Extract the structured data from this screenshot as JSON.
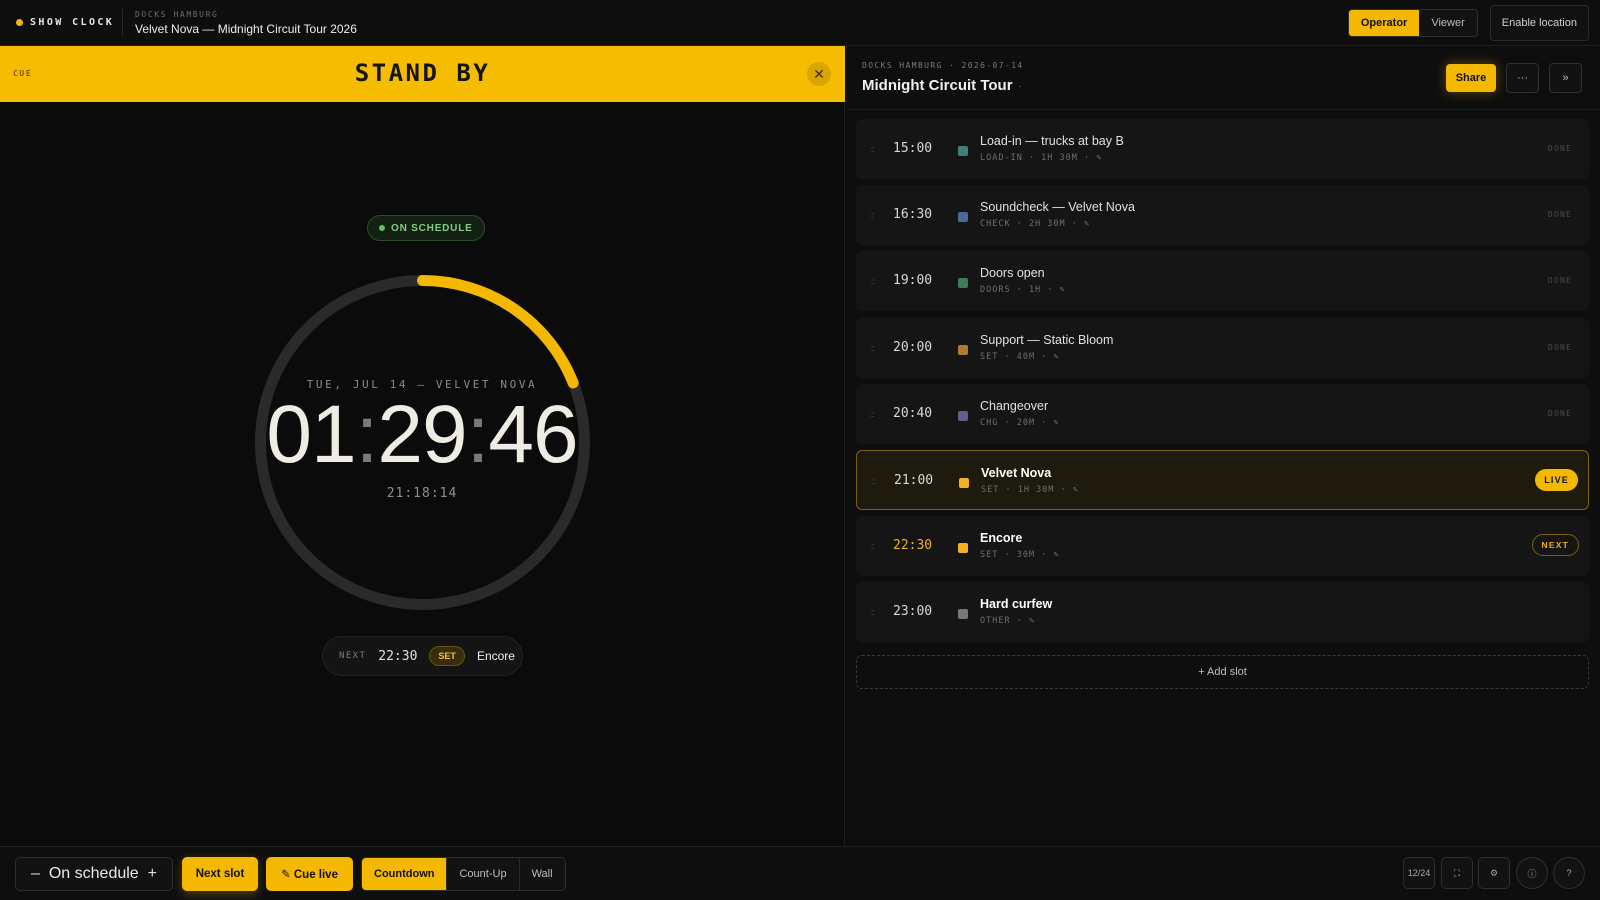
{
  "app": {
    "brand": "SHOW CLOCK",
    "venue": "DOCKS HAMBURG",
    "show_title": "Velvet Nova — Midnight Circuit Tour 2026"
  },
  "topbar": {
    "roles": [
      {
        "label": "Operator",
        "active": true
      },
      {
        "label": "Viewer",
        "active": false
      }
    ],
    "enable_location": "Enable location"
  },
  "cue": {
    "label": "CUE",
    "text": "STAND BY",
    "close_glyph": "✕"
  },
  "clock": {
    "status": "ON SCHEDULE",
    "date_line": "TUE, JUL 14 — VELVET NOVA",
    "hh": "01",
    "mm": "29",
    "ss": "46",
    "now": "21:18:14",
    "progress_fraction": 0.19,
    "colors": {
      "track": "#2a2a2a",
      "progress": "#f5b800"
    }
  },
  "next": {
    "label": "NEXT",
    "time": "22:30",
    "tag": "SET",
    "name": "Encore"
  },
  "rundown": {
    "venue_date": "DOCKS HAMBURG · 2026-07-14",
    "title": "Midnight Circuit Tour",
    "title_suffix": "·",
    "share": "Share",
    "more": "···",
    "collapse": "»",
    "slots": [
      {
        "time": "15:00",
        "title": "Load-in — trucks at bay B",
        "meta": "LOAD-IN · 1H 30M · ✎",
        "color": "#3f7f7a",
        "state": "DONE"
      },
      {
        "time": "16:30",
        "title": "Soundcheck — Velvet Nova",
        "meta": "CHECK · 2H 30M · ✎",
        "color": "#4a6a9a",
        "state": "DONE"
      },
      {
        "time": "19:00",
        "title": "Doors open",
        "meta": "DOORS · 1H · ✎",
        "color": "#3f7a5a",
        "state": "DONE"
      },
      {
        "time": "20:00",
        "title": "Support — Static Bloom",
        "meta": "SET · 40M · ✎",
        "color": "#b07a30",
        "state": "DONE"
      },
      {
        "time": "20:40",
        "title": "Changeover",
        "meta": "CHG · 20M · ✎",
        "color": "#6a5a8a",
        "state": "DONE"
      },
      {
        "time": "21:00",
        "title": "Velvet Nova",
        "meta": "SET · 1H 30M · ✎",
        "color": "#f5b020",
        "state": "LIVE"
      },
      {
        "time": "22:30",
        "title": "Encore",
        "meta": "SET · 30M · ✎",
        "color": "#f5b020",
        "state": "NEXT"
      },
      {
        "time": "23:00",
        "title": "Hard curfew",
        "meta": "OTHER · ✎",
        "color": "#777777",
        "state": ""
      }
    ],
    "add_slot": "+ Add slot"
  },
  "bottombar": {
    "minus": "–",
    "schedule": "On schedule",
    "plus": "+",
    "next_slot": "Next slot",
    "cue_live": "✎  Cue live",
    "modes": [
      {
        "label": "Countdown",
        "active": true
      },
      {
        "label": "Count-Up",
        "active": false
      },
      {
        "label": "Wall",
        "active": false
      }
    ],
    "format_24": "12/24",
    "fullscreen_glyph": "⛶",
    "settings_glyph": "⚙",
    "info_glyph": "ⓘ",
    "help_glyph": "?"
  }
}
